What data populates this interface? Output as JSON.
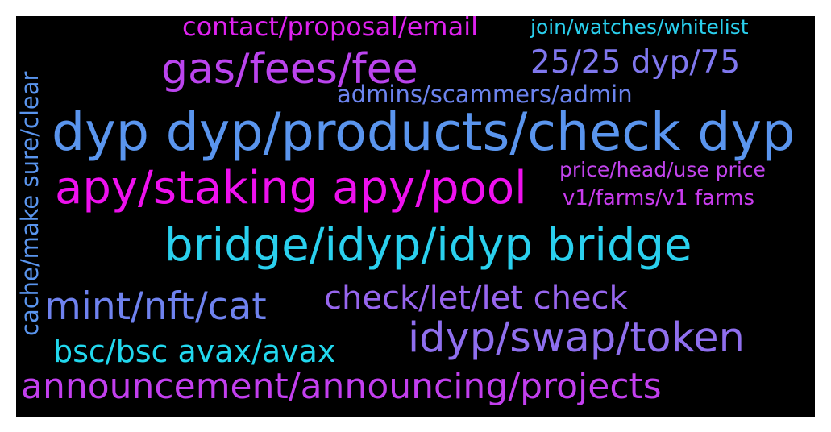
{
  "words": [
    {
      "id": "w1",
      "text": "contact/proposal/email",
      "color": "#dd22ee"
    },
    {
      "id": "w2",
      "text": "join/watches/whitelist",
      "color": "#2ad0ee"
    },
    {
      "id": "w3",
      "text": "gas/fees/fee",
      "color": "#bb44ee"
    },
    {
      "id": "w4",
      "text": "25/25 dyp/75",
      "color": "#7f77ee"
    },
    {
      "id": "w5",
      "text": "admins/scammers/admin",
      "color": "#6c84ee"
    },
    {
      "id": "w6",
      "text": "dyp dyp/products/check dyp",
      "color": "#5a95ee"
    },
    {
      "id": "w7",
      "text": "apy/staking apy/pool",
      "color": "#ee11ee"
    },
    {
      "id": "w8",
      "text": "price/head/use price",
      "color": "#c244ee"
    },
    {
      "id": "w9",
      "text": "v1/farms/v1 farms",
      "color": "#c93cee"
    },
    {
      "id": "w10",
      "text": "bridge/idyp/idyp bridge",
      "color": "#2ad0ee"
    },
    {
      "id": "w11",
      "text": "mint/nft/cat",
      "color": "#6f82ee"
    },
    {
      "id": "w12",
      "text": "check/let/let check",
      "color": "#9766ee"
    },
    {
      "id": "w13",
      "text": "idyp/swap/token",
      "color": "#8f6fee"
    },
    {
      "id": "w14",
      "text": "bsc/bsc avax/avax",
      "color": "#22d8ee"
    },
    {
      "id": "w15",
      "text": "announcement/announcing/projects",
      "color": "#c23fee"
    },
    {
      "id": "w16",
      "text": "cache/make sure/clear",
      "color": "#5a95ee"
    }
  ]
}
